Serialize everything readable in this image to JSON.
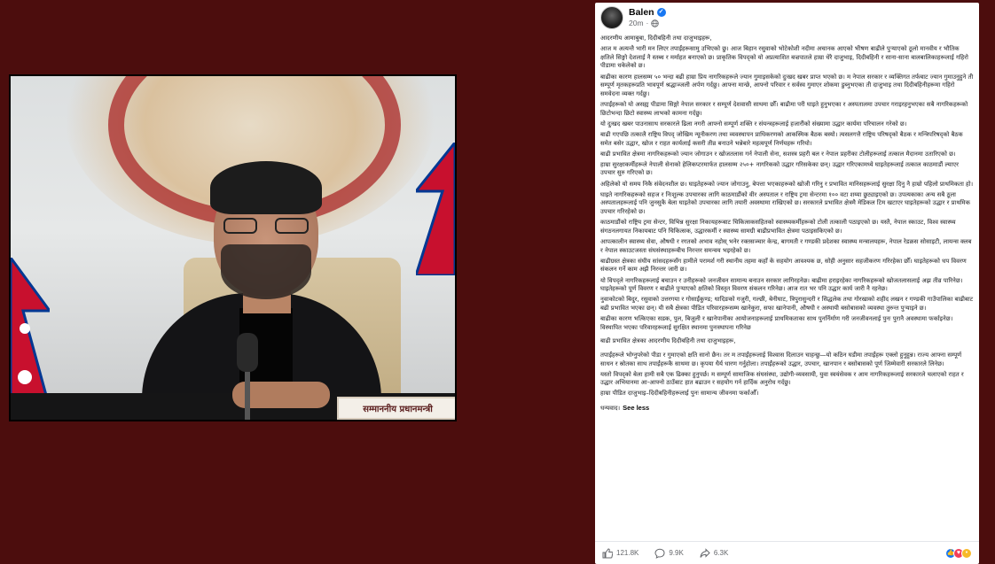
{
  "image_caption": {
    "name_plate": "सम्माननीय प्रधानमन्त्री"
  },
  "post": {
    "author": "Balen",
    "time": "20m",
    "paragraphs": [
      "आदरणीय आमाबुबा, दिदीबहिनी तथा दाजुभाइहरू,",
      "आज म अत्यन्तै भारी मन लिएर तपाईंहरूसामु उभिएको छु। आज बिहान रसुवाको भोटेकोशी नदीमा अचानक आएको भीषण बाढीले पुर्‍याएको ठूलो मानवीय र भौतिक क्षतिले सिङ्गो देशलाई नै स्तब्ध र मर्माहत बनाएको छ। प्राकृतिक विपद्को यो अप्रत्याशित बज्रपातले हाम्रा धेरै दाजुभाइ, दिदीबहिनी र साना-साना बालबालिकाहरूलाई गहिरो पीडामा धकेलेको छ।",
      "बाढीका कारण हालसम्म ५० भन्दा बढी हाम्रा प्रिय नागरिकहरूले ज्यान गुमाइसकेको दुःखद खबर प्राप्त भएको छ। म नेपाल सरकार र व्यक्तिगत तर्फबाट ज्यान गुमाउनुहुने ती सम्पूर्ण मृतकहरूप्रति भावपूर्ण श्रद्धाञ्जली अर्पण गर्दछु। आफ्ना मान्छे, आफ्नो परिवार र सर्वस्व गुमाएर शोकमा डुब्नुभएका ती दाजुभाइ तथा दिदीबहिनीहरूमा गहिरो समवेदना व्यक्त गर्दछु।",
      "तपाईंहरूको यो असह्य पीडामा सिङ्गो नेपाल सरकार र सम्पूर्ण देशवासी साथमा छौँ। बाढीमा परी घाइते हुनुभएका र अस्पतालमा उपचार गराइरहनुभएका सबै नागरिकहरूको छिटोभन्दा छिटो स्वास्थ्य लाभको कामना गर्दछु।",
      "यो दुःखद खबर पाउनासाथ सरकारले ढिला नगरी आफ्नो सम्पूर्ण शक्ति र संयन्त्रहरूलाई हजारौंको संख्यामा उद्धार कार्यमा परिचालन गरेको छ।",
      "बाढी गएपछि तत्कालै राष्ट्रिय विपद् जोखिम न्यूनीकरण तथा व्यवस्थापन प्राधिकरणको आकस्मिक बैठक बस्यो। त्यसलगत्तै राष्ट्रिय परिषद्को बैठक र मन्त्रिपरिषद्को बैठक समेत बसेर उद्धार, खोज र राहत कार्यलाई कसरी तीव्र बनाउने भन्नेबारे महत्वपूर्ण निर्णयहरू गरियो।",
      "बाढी प्रभावित क्षेत्रमा नागरिकहरूको ज्यान जोगाउन र खोजतलास गर्न नेपाली सेना, सशस्त्र प्रहरी बल र नेपाल प्रहरीका टोलीहरूलाई तत्काल मैदानमा उतारिएको छ।",
      "हाम्रा सुरक्षाकर्मीहरूले नेपाली सेनाको हेलिकप्टरमार्फत हालसम्म २५०+ नागरिकको उद्धार गरिसकेका छन्। उद्धार गरिएकामध्ये घाइतेहरूलाई तत्काल काठमाडौं ल्याएर उपचार सुरु गरिएको छ।",
      "अहिलेको यो समय निकै संवेदनशील छ। घाइतेहरूको ज्यान जोगाउनु, बेपत्ता भएकाहरूको खोजी गरिनु र प्रभावित मानिसहरूलाई सुरक्षा दिनु नै हाम्रो पहिलो प्राथमिकता हो।",
      "घाइते नागरिकहरूको सहज र निःशुल्क उपचारका लागि काठमाडौंको वीर अस्पताल र राष्ट्रिय ट्रमा सेन्टरमा १०० वटा शय्या छुट्याइएको छ। उपत्यकाका अन्य सबै ठूला अस्पतालहरूलाई पनि जुनसुकै बेला घाइतेको उपचारका लागि तयारी अवस्थामा राखिएको छ। सरकारले प्रभावित क्षेत्रमै मेडिकल टिम खटाएर घाइतेहरूको उद्धार र प्राथमिक उपचार गरिरहेको छ।",
      "काठमाडौंको राष्ट्रिय ट्रमा सेन्टर, विभिन्न सुरक्षा निकायहरूबाट चिकित्सकसहितको स्वास्थ्यकर्मीहरूको टोली तत्काली पठाइएको छ। यस्तै, नेपाल स्काउट, विश्व स्वास्थ्य संगठनलगायत निकायबाट पनि चिकित्सक, उद्धारकर्मी र स्वास्थ्य सामग्री बाढीप्रभावित क्षेत्रमा पठाइसकिएको छ।",
      "आपत्कालीन स्वास्थ्य सेवा, औषधी र रगतको अभाव नहोस् भनेर रक्तसञ्चार केन्द्र, बागमती र गण्डकी प्रदेशका स्वास्थ्य मन्त्रालयहरू, नेपाल रेडक्रस सोसाइटी, लायन्स क्लब र नेपाल स्काउटजस्ता संघसंस्थाहरूबीच निरन्तर समन्वय भइरहेको छ।",
      "बाढीग्रस्त क्षेत्रका संघीय सांसदहरूसँग हामीले परामर्श गरी स्थानीय तहमा कहाँ के सहयोग आवश्यक छ, सोही अनुसार सहजीकरण गरिरहेका छौँ। घाइतेहरूको धप विवरण संकलन गर्ने काम अझै निरन्तर जारी छ।",
      "यो विपद्ले नागरिकहरूलाई बचाउन र उनीहरूको जनजीवन सामान्य बनाउन सरकार लागिरहनेछ। बाढीमा हराइरहेका नागरिकहरूको खोजतलासलाई अझ तीव्र पारिनेछ। घाइतेहरूको पूर्ण विवरण र बाढीले पुर्‍याएको क्षतिको विस्तृत विवरण संकलन गरिनेछ। आज रात भर पनि उद्धार कार्य जारी नै रहनेछ।",
      "नुवाकोटको बिदुर, रसुवाको उत्तरगया र गोसाईंकुण्ड; धादिङको गजुरी, गल्छी, बेनीघाट, त्रिपुरासुन्दरी र सिद्धलेक तथा गोरखाको शहीद लखन र गण्डकी गाउँपालिका बाढीबाट बढी प्रभावित भएका छन्। यी सबै क्षेत्रका पीडित परिवारहरूसम्म खानेकुरा, सफा खानेपानी, औषधी र अस्थायी बसोबासको व्यवस्था तुरुन्त पुर्‍याइने छ।",
      "बाढीका कारण भत्किएका सडक, पुल, बिजुली र खानेपानीका आयोजनाहरूलाई प्राथमिकताका साथ पुनर्निर्माण गरी जनजीवनलाई पुनः पुरानै अवस्थामा फर्काइनेछ। विस्थापित भएका परिवारहरूलाई सुरक्षित स्थानमा पुनःस्थापना गरिनेछ",
      "बाढी प्रभावित क्षेत्रका आदरणीय दिदीबहिनी तथा दाजुभाइहरू,",
      "तपाईंहरूले भोग्नुपरेको पीडा र गुमाएको क्षति सानो छैन। तर म तपाईंहरूलाई विश्वास दिलाउन चाहन्छु—यो कठिन घडीमा तपाईंहरू एक्लो हुनुहुन्न। राज्य आफ्ना सम्पूर्ण साधन र स्रोतका साथ तपाईंहरूकै साथमा छ। कृपया धैर्य धारण गर्नुहोला। तपाईंहरूको उद्धार, उपचार, खानपान र बसोबासको पूर्ण जिम्मेवारी सरकारले लिनेछ।",
      "यस्तो विपद्को बेला हामी सबै एक ढिक्का हुनुपर्छ। म सम्पूर्ण सामाजिक संघसंस्था, उद्योगी-व्यवसायी, युवा स्वयंसेवक र आम नागरिकहरूलाई सरकारले चलाएको राहत र उद्धार अभियानमा आ-आफ्नो ठाउँबाट हात बढाउन र सहयोग गर्न हार्दिक अनुरोध गर्दछु।",
      "हाम्रा पीडित दाजुभाइ–दिदीबहिनीहरूलाई पुनः सामान्य जीवनमा फर्काऔँ।",
      "धन्यवाद।"
    ],
    "see_less": "See less",
    "likes": "121.8K",
    "comments": "9.9K",
    "shares": "6.3K"
  },
  "colors": {
    "background": "#4c0d0d",
    "card": "#ffffff",
    "facebook_blue": "#1877f2"
  }
}
